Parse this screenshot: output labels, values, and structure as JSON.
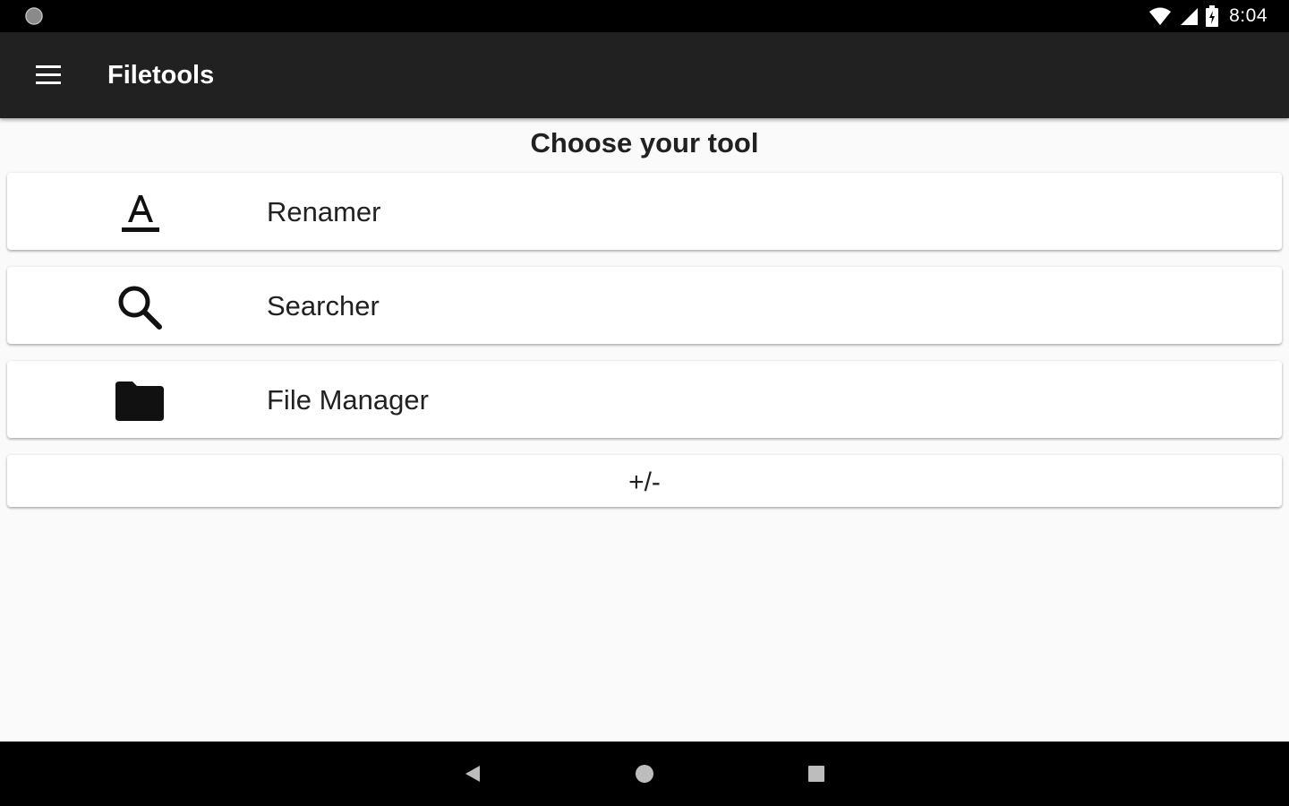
{
  "status_bar": {
    "time": "8:04",
    "icons": [
      "system-dot-icon",
      "wifi-icon",
      "cell-signal-icon",
      "battery-charging-icon"
    ]
  },
  "app_bar": {
    "title": "Filetools",
    "menu_icon": "hamburger-menu-icon"
  },
  "main": {
    "heading": "Choose your tool",
    "tools": [
      {
        "label": "Renamer",
        "icon": "text-format-icon"
      },
      {
        "label": "Searcher",
        "icon": "search-icon"
      },
      {
        "label": "File Manager",
        "icon": "folder-icon"
      }
    ],
    "toggle_label": "+/-"
  },
  "nav_bar": {
    "icons": [
      "back-icon",
      "home-icon",
      "recents-icon"
    ]
  },
  "colors": {
    "status_bar": "#000000",
    "app_bar": "#212121",
    "background": "#fafafa",
    "card": "#ffffff",
    "text": "#212121"
  }
}
